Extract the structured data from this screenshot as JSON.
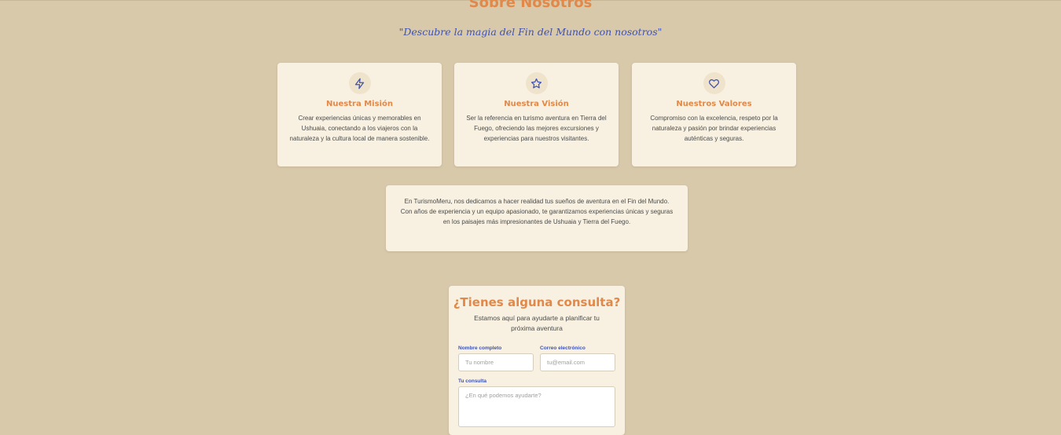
{
  "about": {
    "title": "Sobre Nosotros",
    "tagline": "\"Descubre la magia del Fin del Mundo con nosotros\"",
    "cards": [
      {
        "icon": "lightning-icon",
        "title": "Nuestra Misión",
        "text": "Crear experiencias únicas y memorables en Ushuaia, conectando a los viajeros con la naturaleza y la cultura local de manera sostenible."
      },
      {
        "icon": "star-icon",
        "title": "Nuestra Visión",
        "text": "Ser la referencia en turismo aventura en Tierra del Fuego, ofreciendo las mejores excursiones y experiencias para nuestros visitantes."
      },
      {
        "icon": "heart-icon",
        "title": "Nuestros Valores",
        "text": "Compromiso con la excelencia, respeto por la naturaleza y pasión por brindar experiencias auténticas y seguras."
      }
    ],
    "description": "En TurismoMeru, nos dedicamos a hacer realidad tus sueños de aventura en el Fin del Mundo. Con años de experiencia y un equipo apasionado, te garantizamos experiencias únicas y seguras en los paisajes más impresionantes de Ushuaia y Tierra del Fuego."
  },
  "contact": {
    "title": "¿Tienes alguna consulta?",
    "subtitle": "Estamos aquí para ayudarte a planificar tu próxima aventura",
    "name_label": "Nombre completo",
    "name_placeholder": "Tu nombre",
    "email_label": "Correo electrónico",
    "email_placeholder": "tu@email.com",
    "message_label": "Tu consulta",
    "message_placeholder": "¿En qué podemos ayudarte?"
  },
  "colors": {
    "background": "#d9c9ab",
    "card": "#f8f1e1",
    "accent_orange": "#e0894a",
    "accent_blue": "#3e52b0"
  }
}
